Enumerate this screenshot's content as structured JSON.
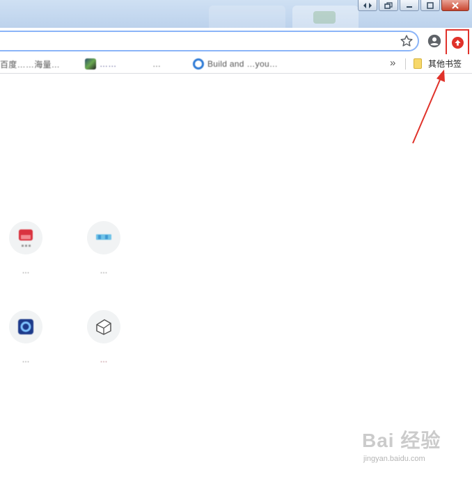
{
  "window": {
    "buttons": [
      "restore-down",
      "minimize",
      "maximize",
      "close"
    ]
  },
  "toolbar": {
    "bookmark_star_icon": "star-outline-icon",
    "profile_icon": "account-circle-icon",
    "extension_icon": "red-upload-icon"
  },
  "bookmarks": {
    "items": [
      {
        "label": "百度……海量…",
        "favicon": "blurred"
      },
      {
        "label": "……",
        "favicon": "blurred-dark"
      },
      {
        "label": "…",
        "favicon": "none"
      },
      {
        "label": "Build and …you…",
        "favicon": "blue-ring"
      }
    ],
    "overflow": "»",
    "other": "其他书签"
  },
  "shortcuts": [
    {
      "label": "…",
      "icon": "red-figure"
    },
    {
      "label": "…",
      "icon": "blue-text"
    },
    {
      "label": "…",
      "icon": "blue-square"
    },
    {
      "label": "…",
      "icon": "gray-box"
    }
  ],
  "annotation": {
    "color": "#e0322a"
  },
  "watermark": {
    "main": "Bai 经验",
    "sub": "jingyan.baidu.com"
  },
  "colors": {
    "accent": "#8ab4f8",
    "highlight": "#e0322a"
  }
}
